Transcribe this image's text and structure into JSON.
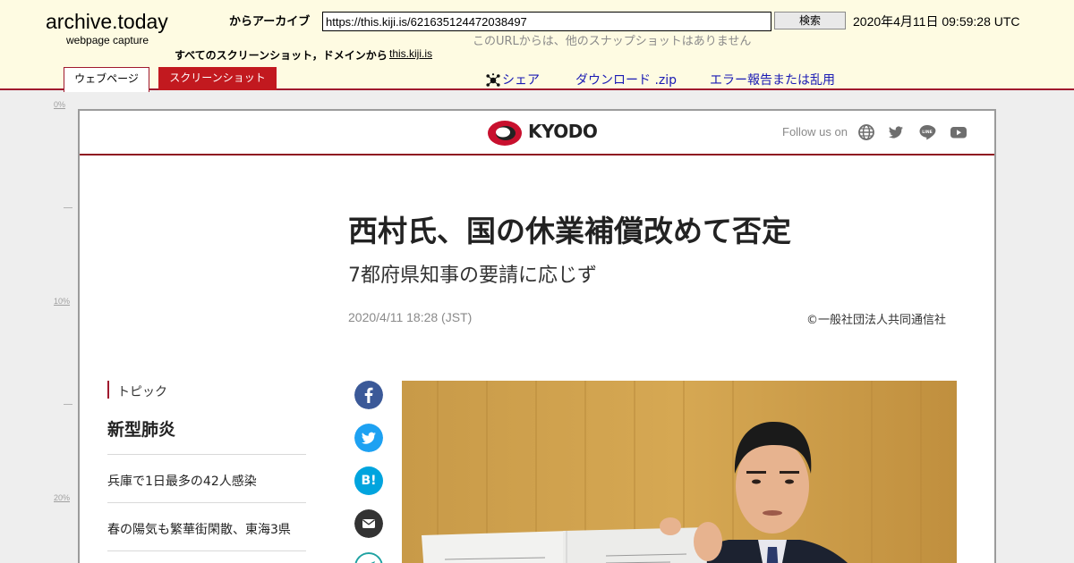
{
  "archive": {
    "brand": "archive.today",
    "brand_sub": "webpage capture",
    "from_archive_label": "からアーカイブ",
    "url_value": "https://this.kiji.is/621635124472038497",
    "search_button": "検索",
    "timestamp": "2020年4月11日 09:59:28 UTC",
    "no_snapshots_msg": "このURLからは、他のスナップショットはありません",
    "all_screenshots_label": "すべてのスクリーンショット，ドメインから",
    "all_screenshots_domain": "this.kiji.is",
    "tabs": [
      {
        "label": "ウェブページ",
        "active": true
      },
      {
        "label": "スクリーンショット",
        "active": false
      }
    ],
    "actions": {
      "share": "シェア",
      "download": "ダウンロード .zip",
      "report": "エラー報告または乱用"
    },
    "ruler": [
      "0%",
      "10%",
      "20%"
    ],
    "colors": {
      "header_bg": "#fefbe2",
      "accent": "#a0192e",
      "link": "#1a1ab4"
    }
  },
  "article": {
    "site_logo": "KYODO",
    "follow_label": "Follow us on",
    "follow_icons": [
      "globe-icon",
      "twitter-icon",
      "line-icon",
      "youtube-icon"
    ],
    "headline": "西村氏、国の休業補償改めて否定",
    "subheadline": "7都府県知事の要請に応じず",
    "date": "2020/4/11 18:28 (JST)",
    "copyright": "©一般社団法人共同通信社",
    "topic": {
      "label": "トピック",
      "name": "新型肺炎",
      "items": [
        "兵庫で1日最多の42人感染",
        "春の陽気も繁華街閑散、東海3県"
      ]
    },
    "share_buttons": [
      {
        "icon": "facebook-icon",
        "glyph": "f"
      },
      {
        "icon": "twitter-icon",
        "glyph": ""
      },
      {
        "icon": "hatena-bookmark-icon",
        "glyph": "B!"
      },
      {
        "icon": "email-icon",
        "glyph": ""
      },
      {
        "icon": "send-icon",
        "glyph": ""
      }
    ],
    "colors": {
      "brand_red": "#c8102e",
      "topic_bar": "#a0192e"
    }
  }
}
